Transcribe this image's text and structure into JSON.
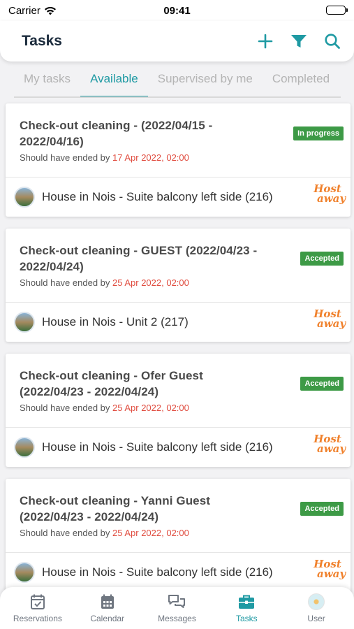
{
  "status_bar": {
    "carrier": "Carrier",
    "time": "09:41"
  },
  "header": {
    "title": "Tasks",
    "icons": [
      "plus-icon",
      "filter-icon",
      "search-icon"
    ]
  },
  "tabs": [
    {
      "label": "My tasks",
      "active": false
    },
    {
      "label": "Available",
      "active": true
    },
    {
      "label": "Supervised by me",
      "active": false
    },
    {
      "label": "Completed",
      "active": false
    }
  ],
  "tasks": [
    {
      "title": "Check-out cleaning - (2022/04/15 - 2022/04/16)",
      "sub_prefix": "Should have ended by ",
      "deadline": "17 Apr 2022, 02:00",
      "status": "In progress",
      "property": "House in Nois - Suite balcony left side (216)",
      "logo": [
        "Host",
        "away"
      ]
    },
    {
      "title": "Check-out cleaning - GUEST (2022/04/23 - 2022/04/24)",
      "sub_prefix": "Should have ended by ",
      "deadline": "25 Apr 2022, 02:00",
      "status": "Accepted",
      "property": "House in Nois - Unit 2 (217)",
      "logo": [
        "Host",
        "away"
      ]
    },
    {
      "title": "Check-out cleaning - Ofer Guest (2022/04/23 - 2022/04/24)",
      "sub_prefix": "Should have ended by ",
      "deadline": "25 Apr 2022, 02:00",
      "status": "Accepted",
      "property": "House in Nois - Suite balcony left side (216)",
      "logo": [
        "Host",
        "away"
      ]
    },
    {
      "title": "Check-out cleaning - Yanni Guest (2022/04/23 - 2022/04/24)",
      "sub_prefix": "Should have ended by ",
      "deadline": "25 Apr 2022, 02:00",
      "status": "Accepted",
      "property": "House in Nois - Suite balcony left side (216)",
      "logo": [
        "Host",
        "away"
      ]
    }
  ],
  "nav": [
    {
      "label": "Reservations",
      "icon": "calendar-check-icon",
      "active": false
    },
    {
      "label": "Calendar",
      "icon": "calendar-grid-icon",
      "active": false
    },
    {
      "label": "Messages",
      "icon": "chat-bubbles-icon",
      "active": false
    },
    {
      "label": "Tasks",
      "icon": "briefcase-icon",
      "active": true
    },
    {
      "label": "User",
      "icon": "user-avatar-icon",
      "active": false
    }
  ],
  "colors": {
    "accent": "#1f9aa3",
    "badge_green": "#3d9a46",
    "deadline_red": "#e04c3f",
    "title_dark": "#1b2b3c",
    "logo_orange": "#f0812c"
  }
}
